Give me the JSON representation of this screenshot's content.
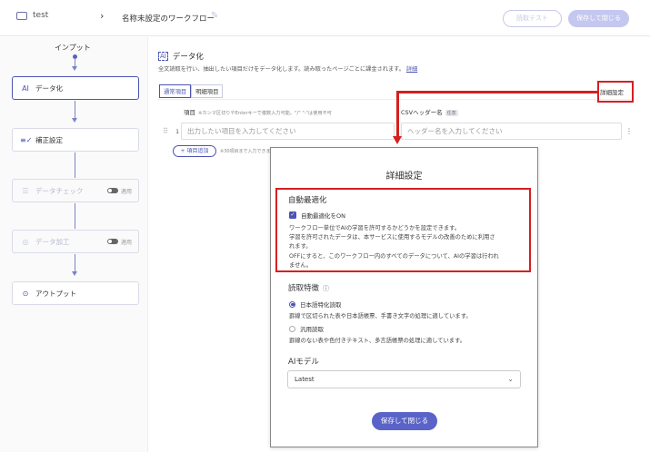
{
  "topbar": {
    "folder_name": "test",
    "breadcrumb_sep": "›",
    "workflow_title": "名称未設定のワークフロー",
    "read_test_label": "読取テスト",
    "save_close_label": "保存して閉じる"
  },
  "flow": {
    "input_label": "インプット",
    "nodes": [
      {
        "label": "データ化",
        "icon": "AI"
      },
      {
        "label": "補正設定",
        "icon": "≡✓"
      },
      {
        "label": "データチェック",
        "icon": "☰",
        "toggle_label": "適用"
      },
      {
        "label": "データ加工",
        "icon": "◎",
        "toggle_label": "適用"
      },
      {
        "label": "アウトプット",
        "icon": "⊙"
      }
    ]
  },
  "main": {
    "title": "データ化",
    "desc": "全文読取を行い、抽出したい項目だけをデータ化します。読み取ったページごとに課金されます。",
    "desc_link": "詳細",
    "tabs": [
      "通常項目",
      "明細項目"
    ],
    "advanced_link": "詳細設定",
    "col_item": "項目",
    "col_item_note": "※カンマ区切りやEnterキーで複数入力可能。\"/\" \"-\"は使用不可",
    "col_csv": "CSVヘッダー名",
    "col_csv_badge": "任意",
    "row_number": "1",
    "item_placeholder": "出力したい項目を入力してください",
    "csv_placeholder": "ヘッダー名を入力してください",
    "add_label": "+ 項目追加",
    "add_note": "※30項目まで入力できます"
  },
  "modal": {
    "title": "詳細設定",
    "auto_opt_title": "自動最適化",
    "auto_opt_checkbox": "自動最適化をON",
    "auto_opt_checked": true,
    "auto_opt_desc": [
      "ワークフロー単位でAIの学習を許可するかどうかを設定できます。",
      "学習を許可されたデータは、本サービスに使用するモデルの改善のために利用さ",
      "れます。",
      "OFFにすると、このワークフロー内のすべてのデータについて、AIの学習は行われ",
      "ません。"
    ],
    "reading_title": "読取特徴",
    "reading_options": [
      {
        "label": "日本語特化読取",
        "desc": "罫線で区切られた表や日本語帳票、手書き文字の処理に適しています。",
        "selected": true
      },
      {
        "label": "汎用読取",
        "desc": "罫線のない表や色付きテキスト、多言語帳票の処理に適しています。",
        "selected": false
      }
    ],
    "ai_model_title": "AIモデル",
    "ai_model_value": "Latest",
    "save_label": "保存して閉じる"
  },
  "colors": {
    "accent": "#4b54b3",
    "annotation": "#d61f1f"
  }
}
